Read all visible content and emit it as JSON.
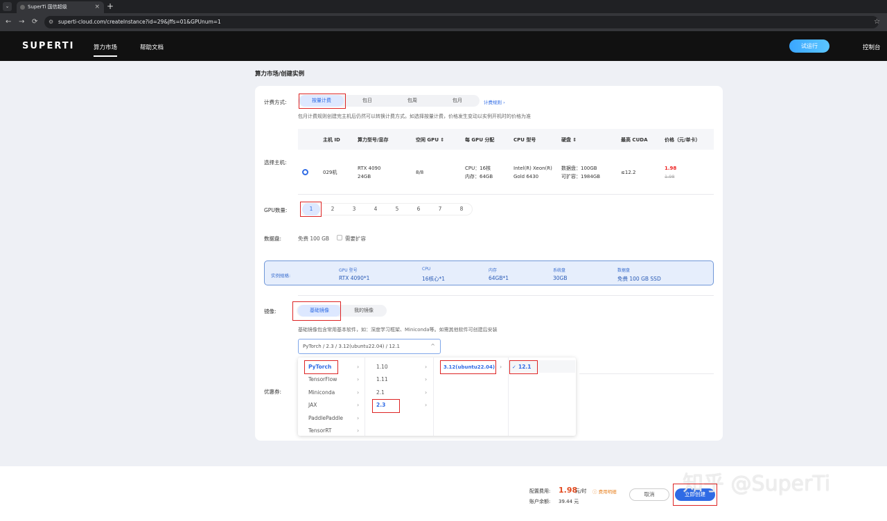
{
  "browser": {
    "tab_title": "SuperTi 国信超级",
    "tab_close": "×",
    "new_tab": "+",
    "tab_menu": "⌄",
    "nav": {
      "back": "←",
      "forward": "→",
      "reload": "⟳"
    },
    "tune_icon": "⚙",
    "url": "superti-cloud.com/createInstance?id=29&jffs=01&GPUnum=1",
    "star": "☆"
  },
  "header": {
    "logo": "SUPERTI",
    "nav_items": [
      "算力市场",
      "帮助文档"
    ],
    "trial_button": "试运行",
    "console_link": "控制台"
  },
  "breadcrumb": "算力市场/创建实例",
  "billing": {
    "label": "计费方式:",
    "options": [
      "按量计费",
      "包日",
      "包周",
      "包月"
    ],
    "selected": "按量计费",
    "rules_link": "计费规则 ›",
    "note": "包月计费规则创建完主机后仍然可以转换计费方式。如选择按量计费，价格发生变动以实例开机时的价格为准"
  },
  "host": {
    "label": "选择主机:",
    "headers": [
      "主机 ID",
      "算力型号/显存",
      "空闲 GPU ⇕",
      "每 GPU 分配",
      "CPU 型号",
      "硬盘 ⇕",
      "最高 CUDA",
      "价格（元/单卡）"
    ],
    "row": {
      "id": "029机",
      "model": "RTX 4090",
      "vram": "24GB",
      "free_gpu": "8/8",
      "cpu_alloc": "CPU：16核",
      "mem_alloc": "内存：64GB",
      "cpu_model_1": "Intel(R) Xeon(R)",
      "cpu_model_2": "Gold 6430",
      "disk_1": "数据盘：100GB",
      "disk_2": "可扩容：1984GB",
      "cuda": "≤12.2",
      "price": "1.98",
      "price_original": "1.98"
    }
  },
  "gpu_count": {
    "label": "GPU数量:",
    "options": [
      "1",
      "2",
      "3",
      "4",
      "5",
      "6",
      "7",
      "8"
    ],
    "selected": "1"
  },
  "data_disk": {
    "label": "数据盘:",
    "free": "免费 100 GB",
    "expand_label": "需要扩容"
  },
  "spec": {
    "label": "实例规格:",
    "items": [
      {
        "k": "GPU 型号",
        "v": "RTX 4090*1"
      },
      {
        "k": "CPU",
        "v": "16核心*1"
      },
      {
        "k": "内存",
        "v": "64GB*1"
      },
      {
        "k": "系统盘",
        "v": "30GB"
      },
      {
        "k": "数据盘",
        "v": "免费 100 GB SSD"
      }
    ]
  },
  "image": {
    "label": "镜像:",
    "tabs": [
      "基础镜像",
      "我的镜像"
    ],
    "note": "基础镜像包含常用基本软件，如：深度学习框架、Miniconda等。如需其他软件可创建后安装",
    "select_value": "PyTorch / 2.3 / 3.12(ubuntu22.04) / 12.1",
    "cascader": {
      "frameworks": [
        "PyTorch",
        "TensorFlow",
        "Miniconda",
        "JAX",
        "PaddlePaddle",
        "TensorRT"
      ],
      "versions": [
        "1.10",
        "1.11",
        "2.1",
        "2.3"
      ],
      "python": [
        "3.12(ubuntu22.04)"
      ],
      "cuda": [
        "12.1"
      ],
      "check": "✓"
    }
  },
  "coupon": {
    "label": "优惠券:"
  },
  "footer": {
    "cost_label": "配置费用:",
    "cost": "1.98",
    "cost_unit": "元/时",
    "detail_link": "ⓘ 费用明细",
    "balance_label": "账户余额:",
    "balance": "39.44 元",
    "cancel": "取消",
    "create": "立即创建"
  },
  "watermark": "知乎 @SuperTi"
}
